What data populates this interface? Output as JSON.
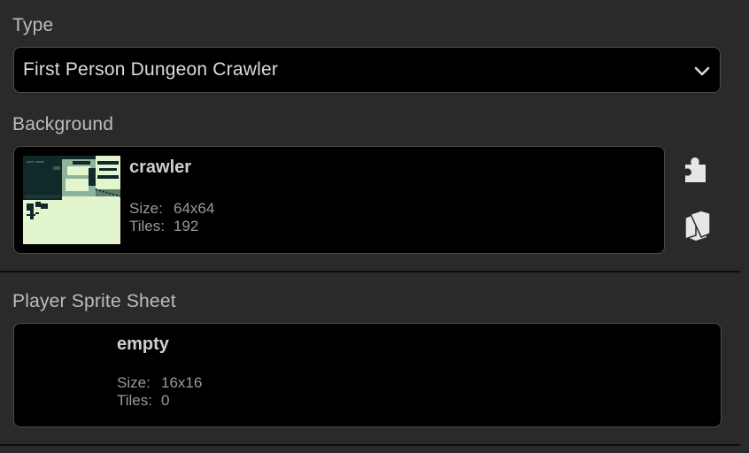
{
  "type_section": {
    "label": "Type",
    "selected": "First Person Dungeon Crawler"
  },
  "background_section": {
    "label": "Background",
    "name": "crawler",
    "size_label": "Size:",
    "size_value": "64x64",
    "tiles_label": "Tiles:",
    "tiles_value": "192",
    "buttons": [
      "puzzle-piece-icon",
      "stacked-copies-icon"
    ]
  },
  "player_sprite_section": {
    "label": "Player Sprite Sheet",
    "name": "empty",
    "size_label": "Size:",
    "size_value": "16x16",
    "tiles_label": "Tiles:",
    "tiles_value": "0"
  },
  "colors": {
    "panel_bg": "#2a2a2a",
    "field_bg": "#000000",
    "thumb_light": "#e3f5cf",
    "thumb_dark": "#102a2a"
  }
}
